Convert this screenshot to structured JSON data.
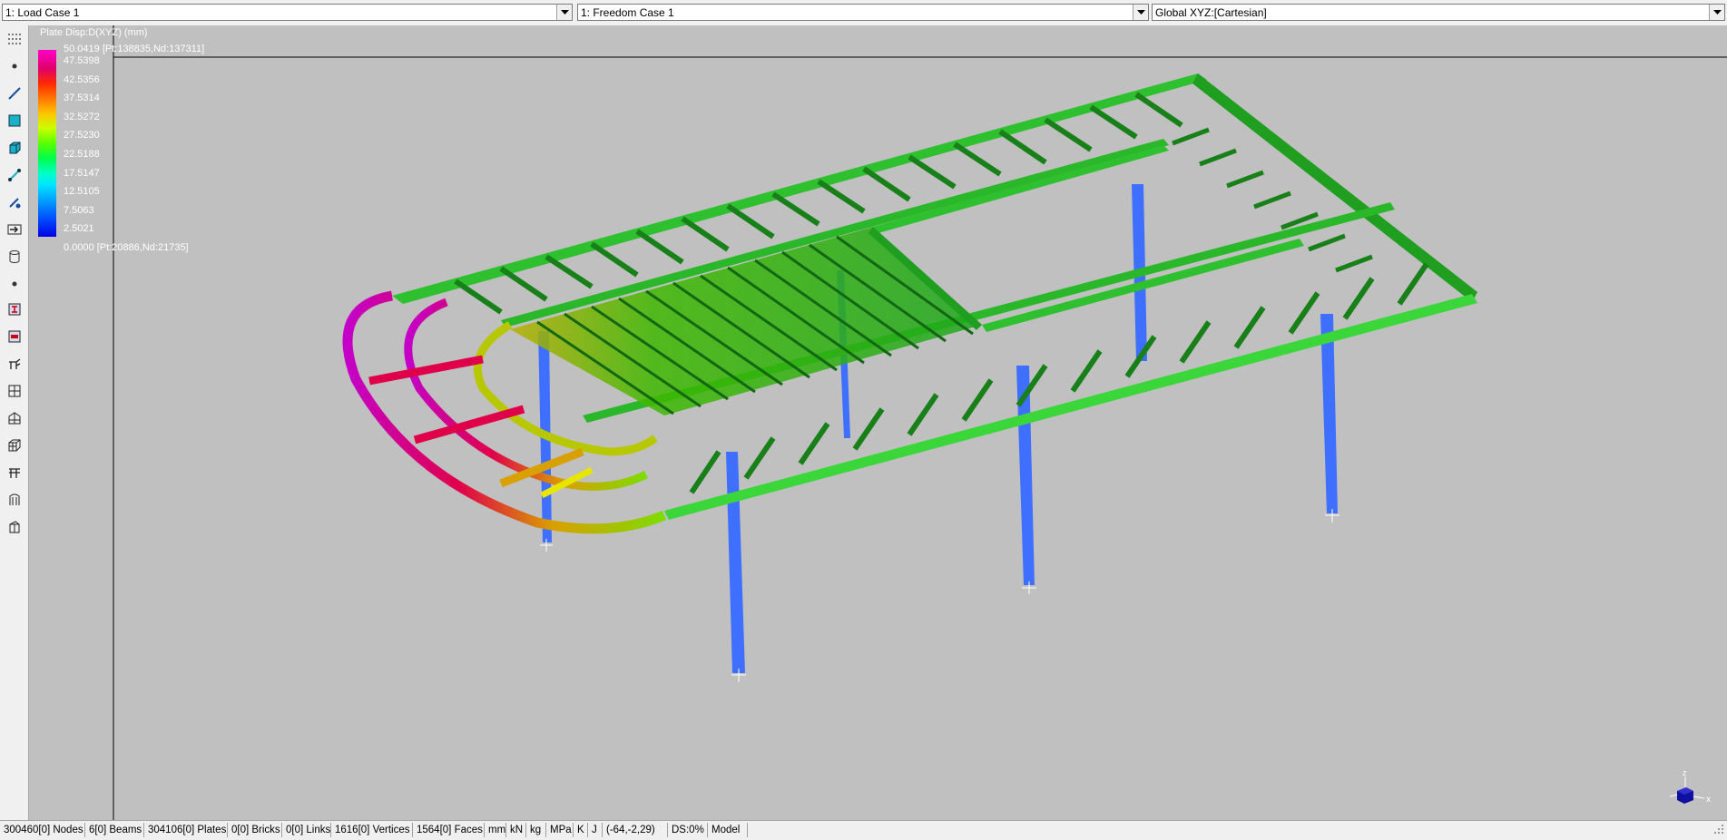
{
  "top_combos": {
    "load_case": "1: Load Case 1",
    "freedom_case": "1: Freedom Case 1",
    "coordinate_system": "Global XYZ:[Cartesian]"
  },
  "toolbar_icons": [
    "grid-dots-icon",
    "node-icon",
    "beam-icon",
    "plate-icon",
    "brick-icon",
    "link-icon",
    "load-icon",
    "attribute-icon",
    "cylinder-icon",
    "point-icon",
    "section-icon",
    "beam-section-icon",
    "structure-icon",
    "mesh-grid-icon",
    "frame-icon",
    "cube-mesh-icon",
    "portal-icon",
    "shell-icon",
    "surface-icon"
  ],
  "legend": {
    "title": "Plate Disp:D(XYZ) (mm)",
    "max_label": "50.0419 [Pt:138835,Nd:137311]",
    "values": [
      "47.5398",
      "42.5356",
      "37.5314",
      "32.5272",
      "27.5230",
      "22.5188",
      "17.5147",
      "12.5105",
      "7.5063",
      "2.5021"
    ],
    "min_label": "0.0000 [Pt:20886,Nd:21735]"
  },
  "colors": {
    "viewport_bg": "#c0c0c0",
    "frame_green": "#22cc22",
    "column_blue": "#3f6fff",
    "bow_red": "#e0004a",
    "bow_magenta": "#c400c8",
    "bow_yellow": "#e6e600"
  },
  "triad": {
    "z": "z",
    "x": "x"
  },
  "status": {
    "nodes": "300460[0] Nodes",
    "beams": "6[0] Beams",
    "plates": "304106[0] Plates",
    "bricks": "0[0] Bricks",
    "links": "0[0] Links",
    "vertices": "1616[0] Vertices",
    "faces": "1564[0] Faces",
    "unit_length": "mm",
    "unit_force": "kN",
    "unit_mass": "kg",
    "unit_stress": "MPa",
    "unit_temp": "K",
    "unit_energy": "J",
    "cursor": "(-64,-2,29)",
    "ds": "DS:0%",
    "mode": "Model"
  }
}
